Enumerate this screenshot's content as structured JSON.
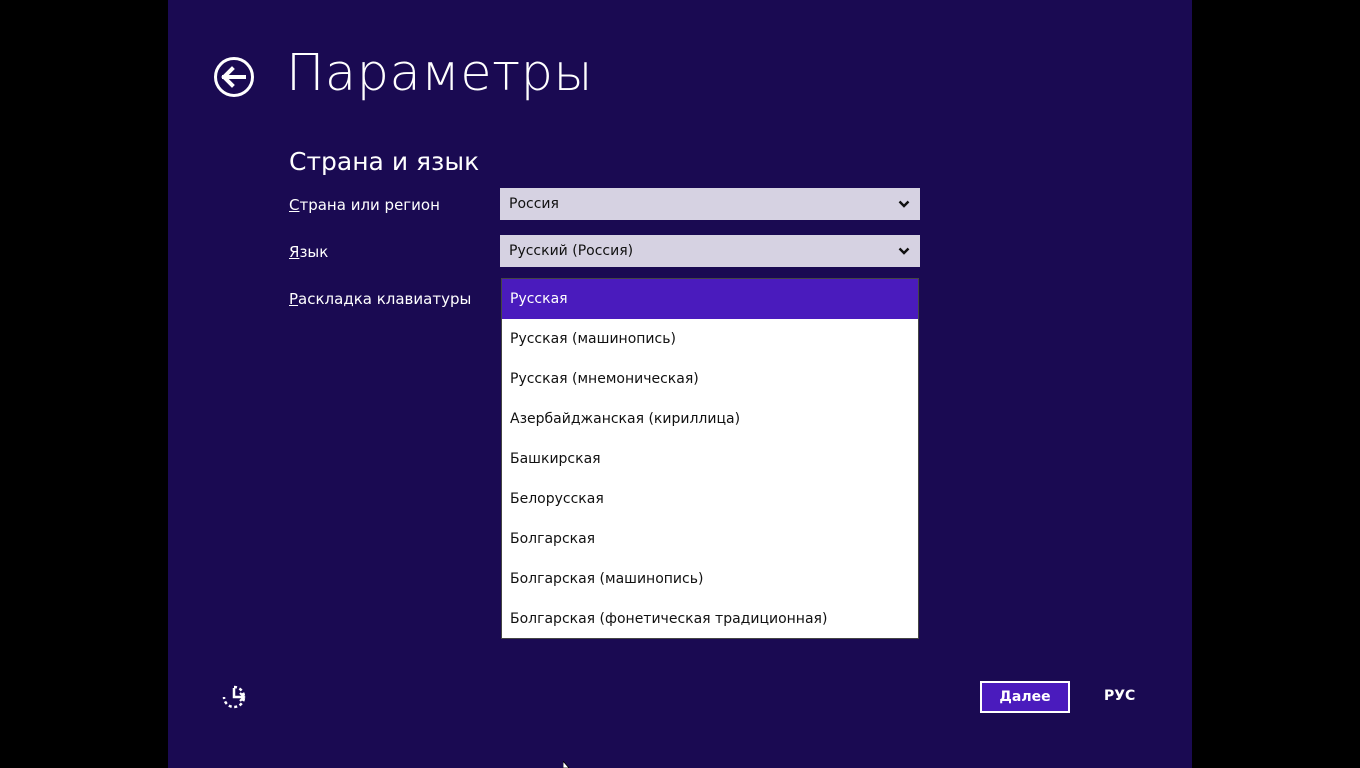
{
  "window": {
    "title": "Параметры"
  },
  "section": {
    "title": "Страна и язык"
  },
  "fields": {
    "country": {
      "label_underlined": "С",
      "label_rest": "трана или регион",
      "value": "Россия"
    },
    "language": {
      "label_underlined": "Я",
      "label_rest": "зык",
      "value": "Русский (Россия)"
    },
    "keyboard": {
      "label_underlined": "Р",
      "label_rest": "аскладка клавиатуры"
    }
  },
  "keyboard_options": [
    "Русская",
    "Русская (машинопись)",
    "Русская (мнемоническая)",
    "Азербайджанская (кириллица)",
    "Башкирская",
    "Белорусская",
    "Болгарская",
    "Болгарская (машинопись)",
    "Болгарская (фонетическая традиционная)"
  ],
  "selected_option": "Русская",
  "footer": {
    "next_label": "Далее",
    "input_language": "РУС"
  },
  "icons": {
    "back": "back-arrow-circle-icon",
    "accessibility": "ease-of-access-icon",
    "chevron": "chevron-down-icon"
  },
  "colors": {
    "background": "#1a0a52",
    "accent": "#4a1bbd",
    "select_bg": "#d6d2e2"
  }
}
